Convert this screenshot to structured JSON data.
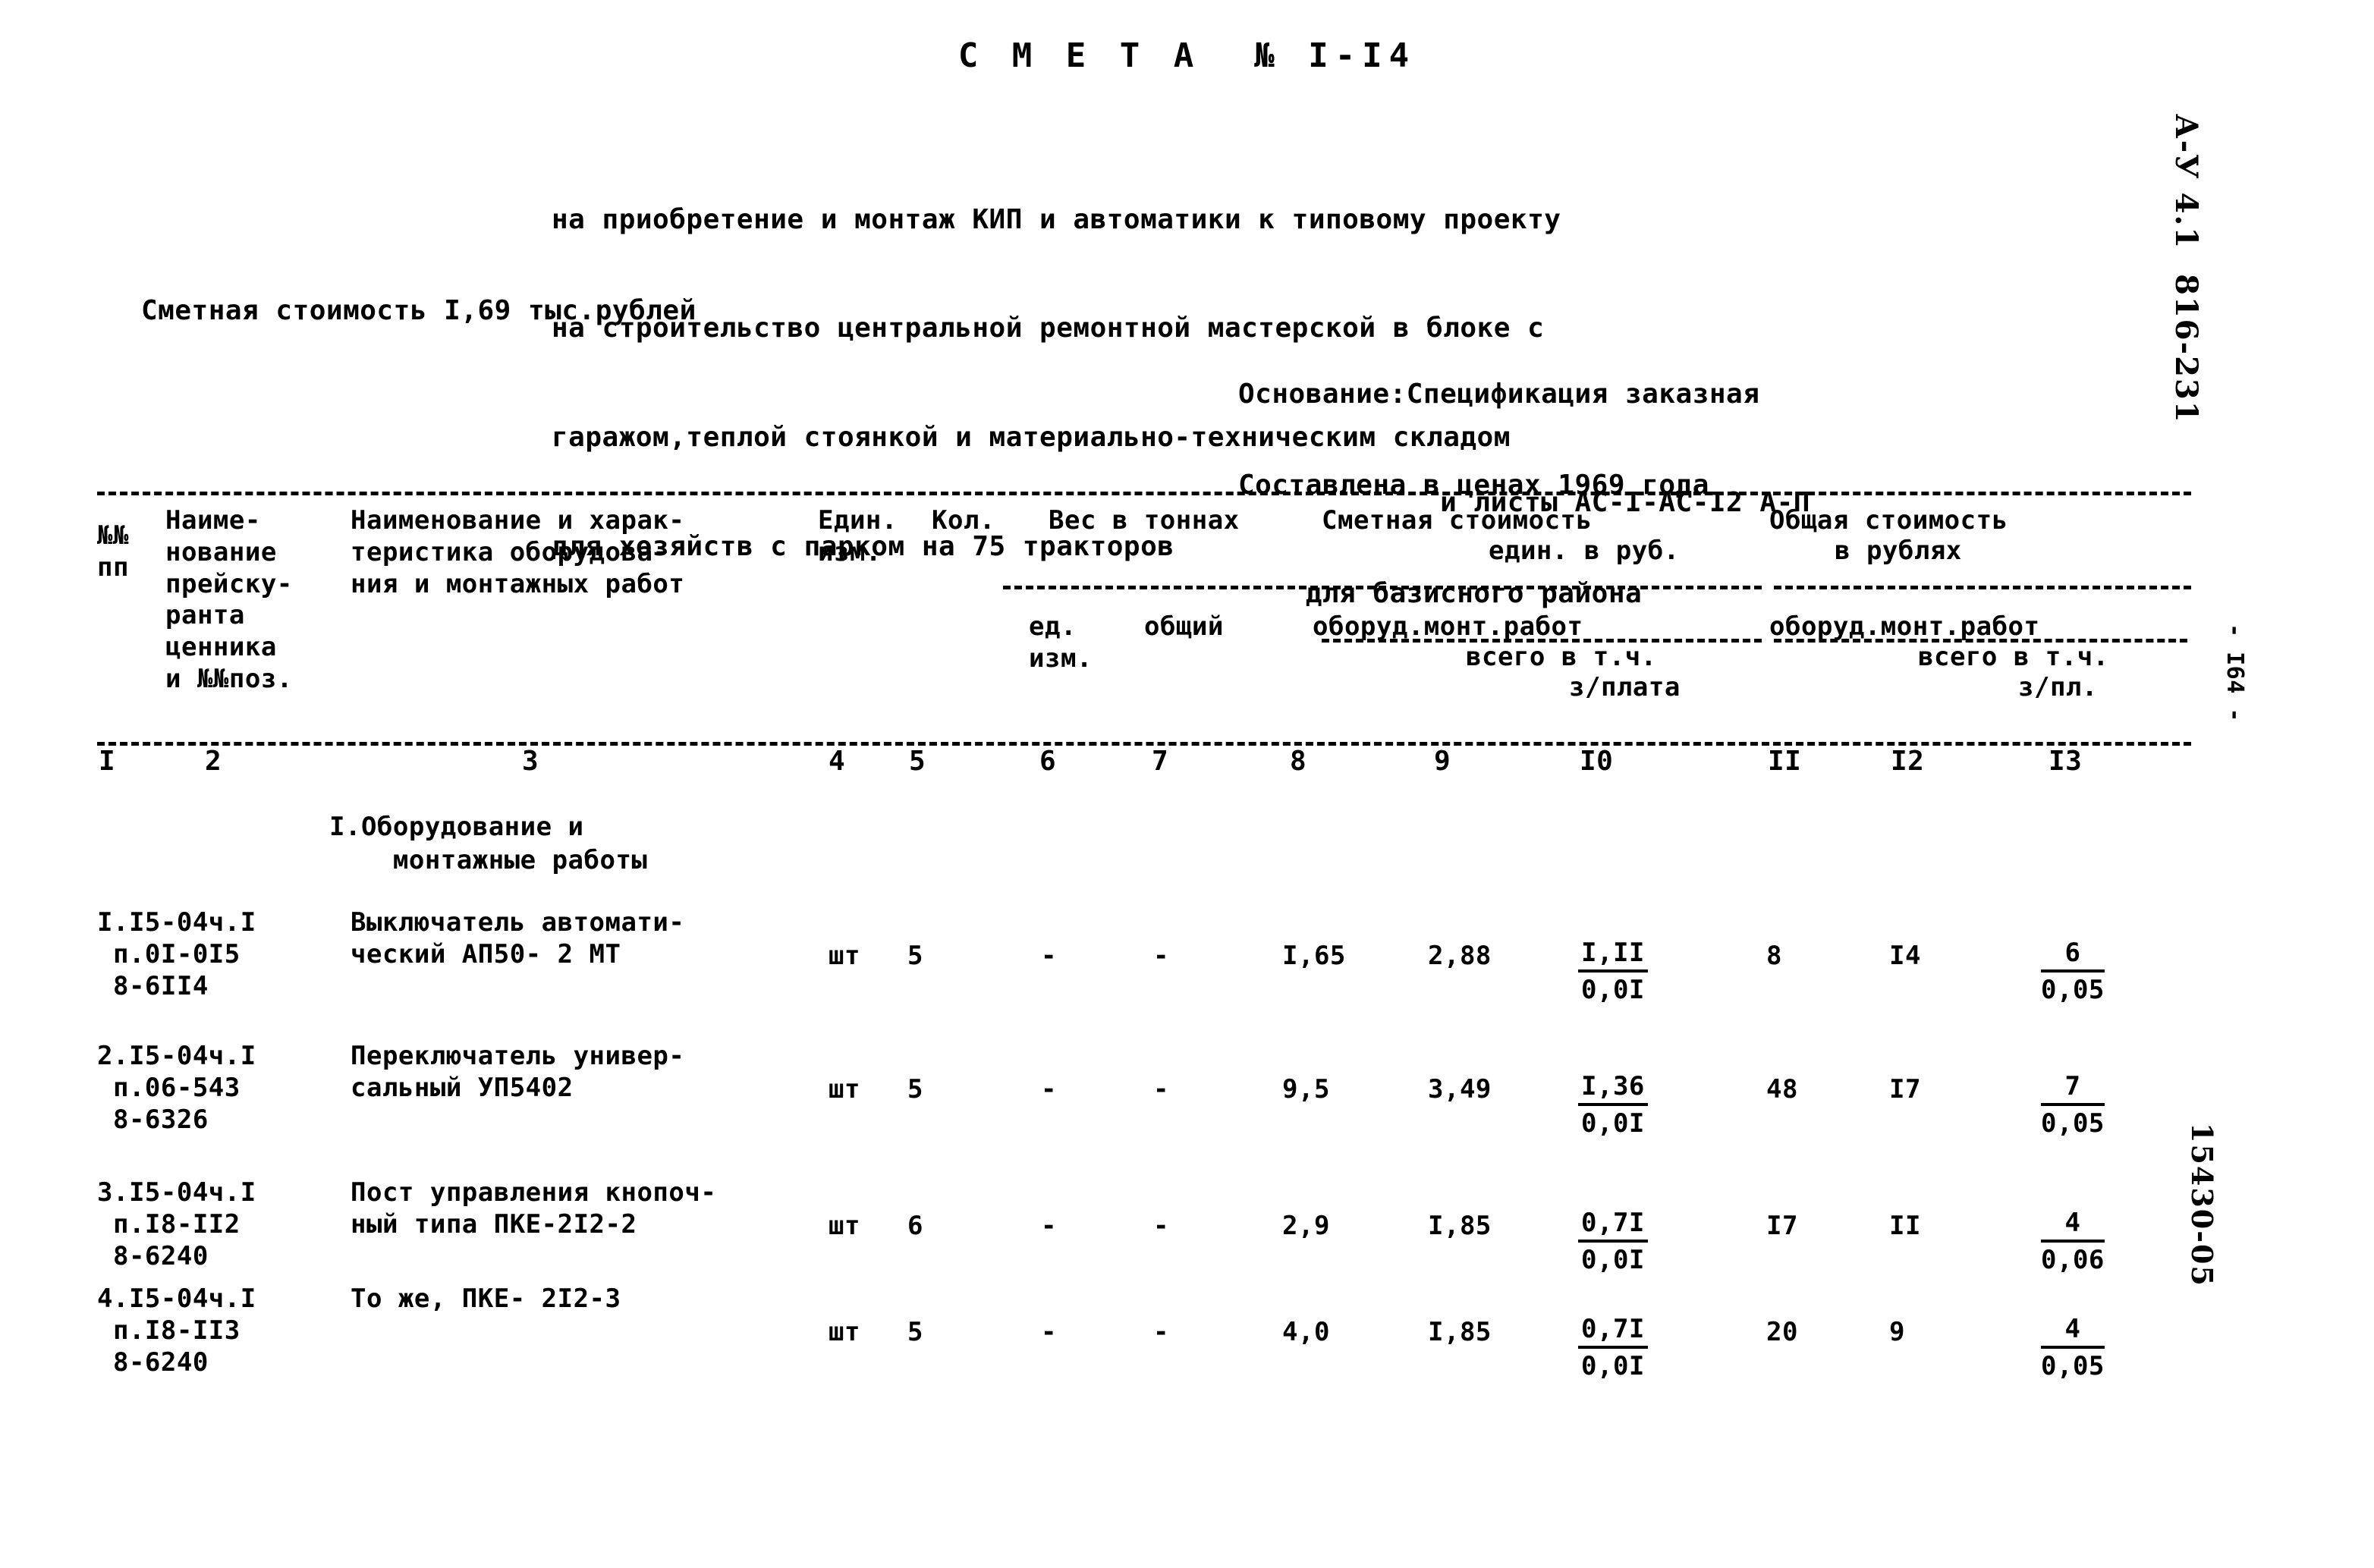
{
  "document": {
    "title": "С М Е Т А  № I-I4",
    "subtitle_lines": [
      "на приобретение и монтаж КИП и автоматики к типовому проекту",
      "на строительство центральной ремонтной мастерской в блоке с",
      "гаражом,теплой стоянкой и материально-техническим складом",
      "для хозяйств с парком на 75 тракторов"
    ],
    "cost_line": "Сметная стоимость I,69 тыс.рублей",
    "basis_lines": [
      "Основание:Спецификация заказная",
      "            и листы АС-I-АС-I2 А-П"
    ],
    "prices_lines": [
      "Составлена в ценах 1969 года",
      "    для базисного района"
    ]
  },
  "margin": {
    "archive_mark": "А-У 4.1  816-231",
    "page_number": "- I64 -",
    "shelf_mark": "15430-05"
  },
  "table": {
    "headers": {
      "col1": "№№\nпп",
      "col2": "Наиме-\nнование\nпрейску-\nранта\nценника\nи №№поз.",
      "col3": "Наименование и харак-\nтеристика оборудова-\nния и монтажных работ",
      "col4": "Един.\nизм.",
      "col5": "Кол.",
      "weight_group": "Вес в тоннах",
      "weight_unit": "ед.\nизм.",
      "weight_total": "общий",
      "smeta_group": "Сметная стоимость",
      "smeta_group_sub": "един. в руб.",
      "smeta_oborud": "оборуд.монт.работ",
      "smeta_vsego": "всего в т.ч.",
      "smeta_zplata": "з/плата",
      "total_group": "Общая стоимость",
      "total_group_sub": "в рублях",
      "total_oborud": "оборуд.монт.работ",
      "total_vsego": "всего в т.ч.",
      "total_zpl": "з/пл."
    },
    "column_numbers": [
      "I",
      "2",
      "3",
      "4",
      "5",
      "6",
      "7",
      "8",
      "9",
      "I0",
      "II",
      "I2",
      "I3"
    ],
    "section_heading": "I.Оборудование и\n    монтажные работы",
    "rows": [
      {
        "code": "I.I5-04ч.I\n п.0I-0I5\n 8-6II4",
        "name": "Выключатель автомати-\nческий АП50- 2 МТ",
        "unit": "шт",
        "qty": "5",
        "weight_unit": "-",
        "weight_total": "-",
        "price_equipment": "I,65",
        "price_mounting": "2,88",
        "price_frac_num": "I,II",
        "price_frac_den": "0,0I",
        "total_equipment": "8",
        "total_mounting": "I4",
        "total_frac_num": "6",
        "total_frac_den": "0,05"
      },
      {
        "code": "2.I5-04ч.I\n п.06-543\n 8-6326",
        "name": "Переключатель универ-\nсальный УП5402",
        "unit": "шт",
        "qty": "5",
        "weight_unit": "-",
        "weight_total": "-",
        "price_equipment": "9,5",
        "price_mounting": "3,49",
        "price_frac_num": "I,36",
        "price_frac_den": "0,0I",
        "total_equipment": "48",
        "total_mounting": "I7",
        "total_frac_num": "7",
        "total_frac_den": "0,05"
      },
      {
        "code": "3.I5-04ч.I\n п.I8-II2\n 8-6240",
        "name": "Пост управления кнопоч-\nный типа ПКЕ-2I2-2",
        "unit": "шт",
        "qty": "6",
        "weight_unit": "-",
        "weight_total": "-",
        "price_equipment": "2,9",
        "price_mounting": "I,85",
        "price_frac_num": "0,7I",
        "price_frac_den": "0,0I",
        "total_equipment": "I7",
        "total_mounting": "II",
        "total_frac_num": "4",
        "total_frac_den": "0,06"
      },
      {
        "code": "4.I5-04ч.I\n п.I8-II3\n 8-6240",
        "name": "То же, ПКЕ- 2I2-3",
        "unit": "шт",
        "qty": "5",
        "weight_unit": "-",
        "weight_total": "-",
        "price_equipment": "4,0",
        "price_mounting": "I,85",
        "price_frac_num": "0,7I",
        "price_frac_den": "0,0I",
        "total_equipment": "20",
        "total_mounting": "9",
        "total_frac_num": "4",
        "total_frac_den": "0,05"
      }
    ]
  }
}
